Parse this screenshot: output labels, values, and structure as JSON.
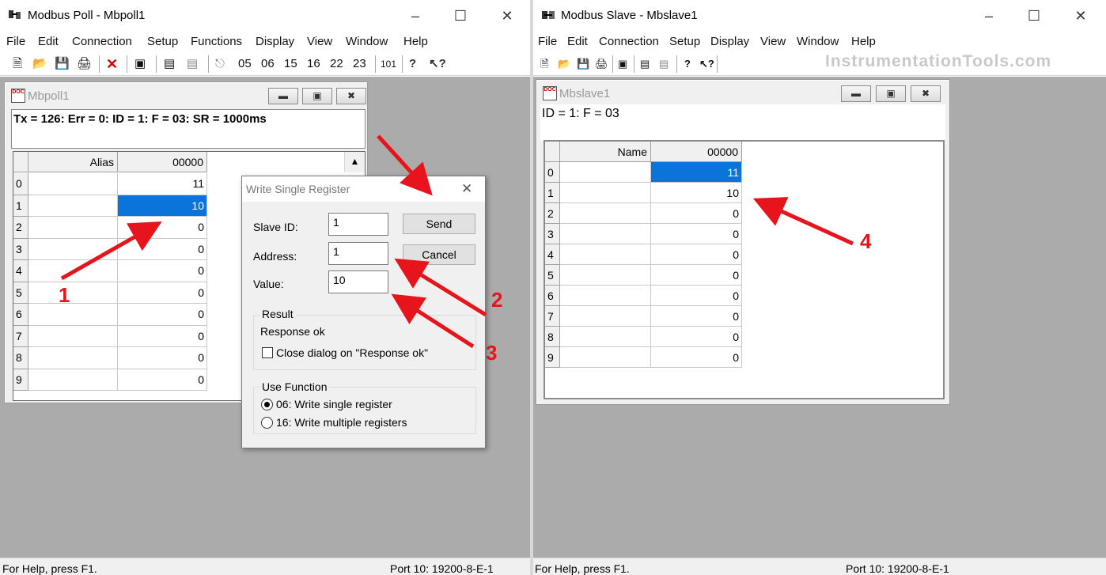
{
  "poll": {
    "title": "Modbus Poll - Mbpoll1",
    "menu": [
      "File",
      "Edit",
      "Connection",
      "Setup",
      "Functions",
      "Display",
      "View",
      "Window",
      "Help"
    ],
    "toolbar_codes": [
      "05",
      "06",
      "15",
      "16",
      "22",
      "23",
      "101"
    ],
    "child_title": "Mbpoll1",
    "info": "Tx = 126: Err = 0: ID = 1: F = 03: SR = 1000ms",
    "col_alias": "Alias",
    "col_addr": "00000",
    "rows": [
      {
        "idx": "0",
        "val": "11"
      },
      {
        "idx": "1",
        "val": "10"
      },
      {
        "idx": "2",
        "val": "0"
      },
      {
        "idx": "3",
        "val": "0"
      },
      {
        "idx": "4",
        "val": "0"
      },
      {
        "idx": "5",
        "val": "0"
      },
      {
        "idx": "6",
        "val": "0"
      },
      {
        "idx": "7",
        "val": "0"
      },
      {
        "idx": "8",
        "val": "0"
      },
      {
        "idx": "9",
        "val": "0"
      }
    ],
    "status_left": "For Help, press F1.",
    "status_right": "Port 10: 19200-8-E-1"
  },
  "dialog": {
    "title": "Write Single Register",
    "slave_id_label": "Slave ID:",
    "slave_id": "1",
    "address_label": "Address:",
    "address": "1",
    "value_label": "Value:",
    "value": "10",
    "send": "Send",
    "cancel": "Cancel",
    "result_group": "Result",
    "result_text": "Response ok",
    "close_check": "Close dialog on \"Response ok\"",
    "function_group": "Use Function",
    "opt06": "06: Write single register",
    "opt16": "16: Write multiple registers"
  },
  "slave": {
    "title": "Modbus Slave - Mbslave1",
    "menu": [
      "File",
      "Edit",
      "Connection",
      "Setup",
      "Display",
      "View",
      "Window",
      "Help"
    ],
    "child_title": "Mbslave1",
    "info": "ID = 1: F = 03",
    "col_name": "Name",
    "col_addr": "00000",
    "rows": [
      {
        "idx": "0",
        "val": "11"
      },
      {
        "idx": "1",
        "val": "10"
      },
      {
        "idx": "2",
        "val": "0"
      },
      {
        "idx": "3",
        "val": "0"
      },
      {
        "idx": "4",
        "val": "0"
      },
      {
        "idx": "5",
        "val": "0"
      },
      {
        "idx": "6",
        "val": "0"
      },
      {
        "idx": "7",
        "val": "0"
      },
      {
        "idx": "8",
        "val": "0"
      },
      {
        "idx": "9",
        "val": "0"
      }
    ],
    "status_left": "For Help, press F1.",
    "status_right": "Port 10: 19200-8-E-1"
  },
  "watermark": "InstrumentationTools.com",
  "annotations": [
    "1",
    "2",
    "3",
    "4"
  ],
  "colors": {
    "selection": "#0a74da",
    "annotation": "#e8141c",
    "mdi_background": "#ababab"
  }
}
